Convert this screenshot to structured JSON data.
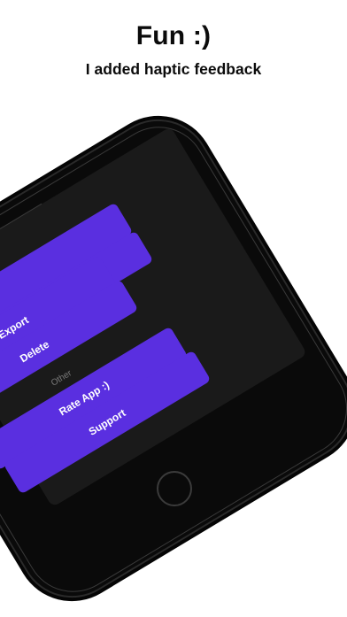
{
  "header": {
    "title": "Fun :)",
    "subtitle": "I added haptic feedback"
  },
  "screen": {
    "buttons": [
      {
        "label": ""
      },
      {
        "label": ""
      },
      {
        "label": "Export"
      },
      {
        "label": "Delete"
      },
      {
        "label": "Rate App :)"
      },
      {
        "label": "Support"
      }
    ],
    "section_other": "Other"
  },
  "colors": {
    "accent": "#5a2fe0",
    "phone_body": "#0a0a0a",
    "screen_bg": "#1a1a1a",
    "section_text": "#7a7a7a"
  }
}
